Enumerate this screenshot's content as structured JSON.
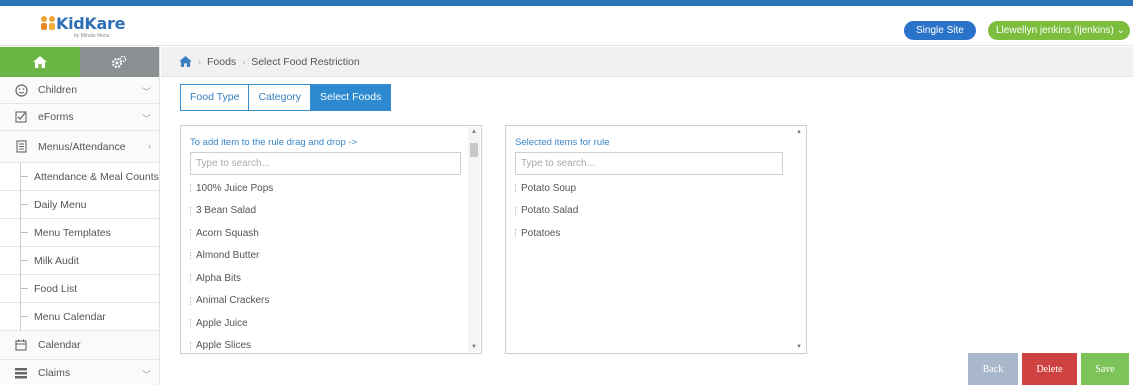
{
  "header": {
    "logo_text": "KidKare",
    "logo_sub": "by Minute Menu",
    "site_button": "Single Site",
    "user_menu": "Llewellyn jenkins (ljenkins)"
  },
  "sidebar": {
    "items": [
      {
        "label": "Children"
      },
      {
        "label": "eForms"
      },
      {
        "label": "Menus/Attendance"
      }
    ],
    "subitems": [
      {
        "label": "Attendance & Meal Counts"
      },
      {
        "label": "Daily Menu"
      },
      {
        "label": "Menu Templates"
      },
      {
        "label": "Milk Audit"
      },
      {
        "label": "Food List"
      },
      {
        "label": "Menu Calendar"
      }
    ],
    "bottom_items": [
      {
        "label": "Calendar"
      },
      {
        "label": "Claims"
      }
    ]
  },
  "breadcrumb": {
    "items": [
      "Foods",
      "Select Food Restriction"
    ]
  },
  "tabs": [
    {
      "label": "Food Type"
    },
    {
      "label": "Category"
    },
    {
      "label": "Select Foods"
    }
  ],
  "left_panel": {
    "title": "To add item to the rule drag and drop ->",
    "search_placeholder": "Type to search...",
    "items": [
      "100% Juice Pops",
      "3 Bean Salad",
      "Acorn Squash",
      "Almond Butter",
      "Alpha Bits",
      "Animal Crackers",
      "Apple Juice",
      "Apple Slices"
    ]
  },
  "right_panel": {
    "title": "Selected items for rule",
    "search_placeholder": "Type to search...",
    "items": [
      "Potato Soup",
      "Potato Salad",
      "Potatoes"
    ]
  },
  "buttons": {
    "back": "Back",
    "delete": "Delete",
    "save": "Save"
  },
  "colors": {
    "top_bar": "#2b73b6",
    "sidebar_home": "#6ab544",
    "active_tab": "#2d8ad1",
    "delete": "#cf4242",
    "save": "#7cc45a",
    "back": "#a8b7c9"
  }
}
